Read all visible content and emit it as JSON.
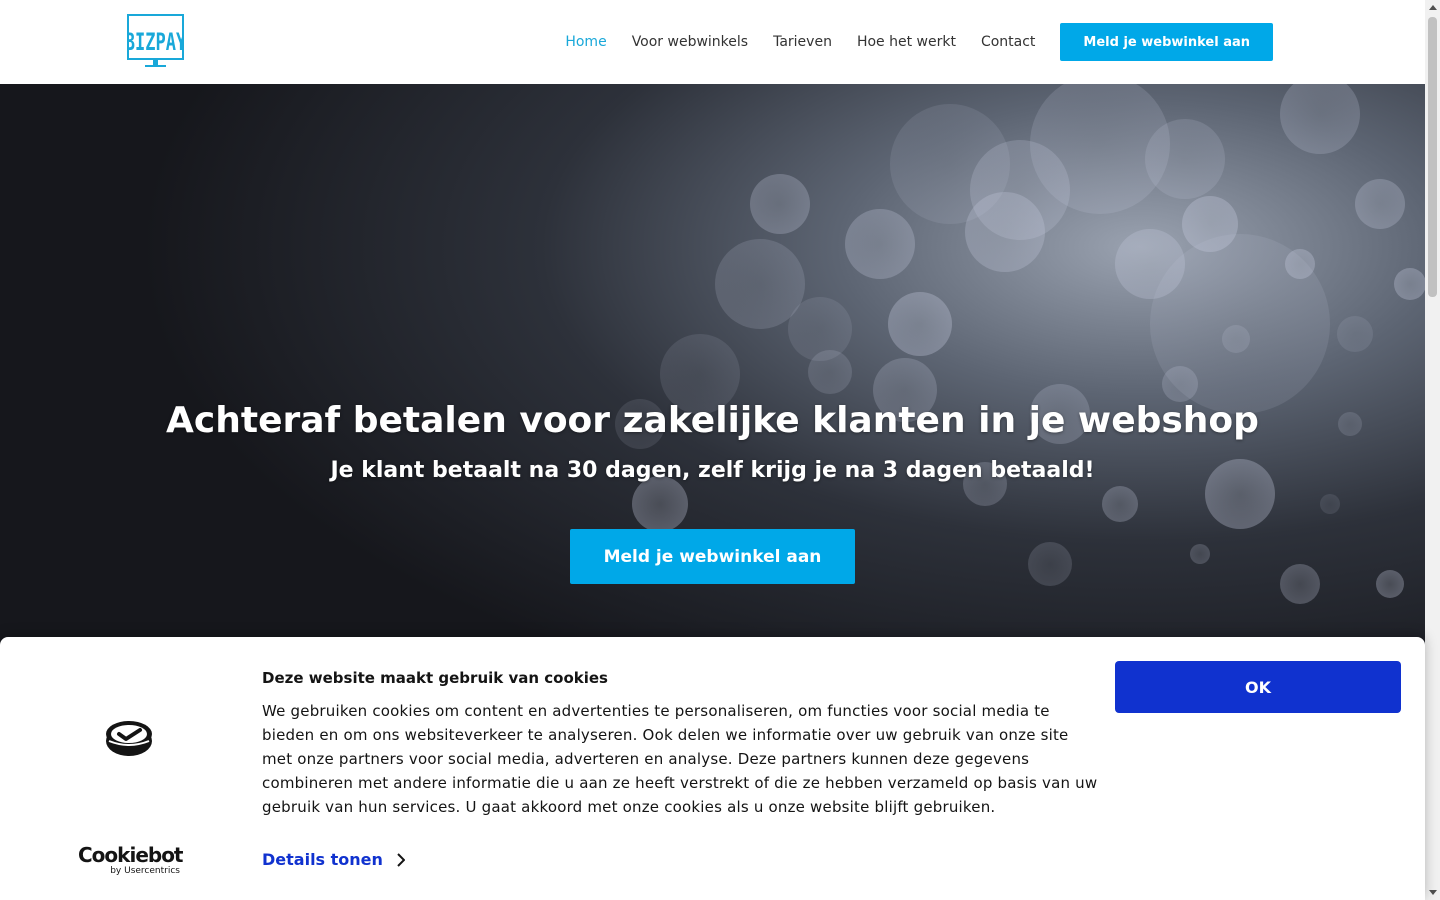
{
  "header": {
    "logo_alt": "BIZPAY",
    "nav": [
      {
        "label": "Home",
        "active": true
      },
      {
        "label": "Voor webwinkels",
        "active": false
      },
      {
        "label": "Tarieven",
        "active": false
      },
      {
        "label": "Hoe het werkt",
        "active": false
      },
      {
        "label": "Contact",
        "active": false
      }
    ],
    "cta_label": "Meld je webwinkel aan"
  },
  "hero": {
    "title": "Achteraf betalen voor zakelijke klanten in je webshop",
    "subtitle": "Je klant betaalt na 30 dagen, zelf krijg je na 3 dagen betaald!",
    "button_label": "Meld je webwinkel aan"
  },
  "cookie_banner": {
    "title": "Deze website maakt gebruik van cookies",
    "text": "We gebruiken cookies om content en advertenties te personaliseren, om functies voor social media te bieden en om ons websiteverkeer te analyseren. Ook delen we informatie over uw gebruik van onze site met onze partners voor social media, adverteren en analyse. Deze partners kunnen deze gegevens combineren met andere informatie die u aan ze heeft verstrekt of die ze hebben verzameld op basis van uw gebruik van hun services. U gaat akkoord met onze cookies als u onze website blijft gebruiken.",
    "details_label": "Details tonen",
    "ok_label": "OK",
    "brand": "Cookiebot",
    "brand_sub": "by Usercentrics"
  },
  "colors": {
    "accent": "#00a8e8",
    "nav_active": "#19a8d9",
    "cookie_button": "#1032cf"
  },
  "icons": [
    "bizpay-logo",
    "cookiebot-icon",
    "chevron-right-icon",
    "scroll-up-icon",
    "scroll-down-icon"
  ]
}
